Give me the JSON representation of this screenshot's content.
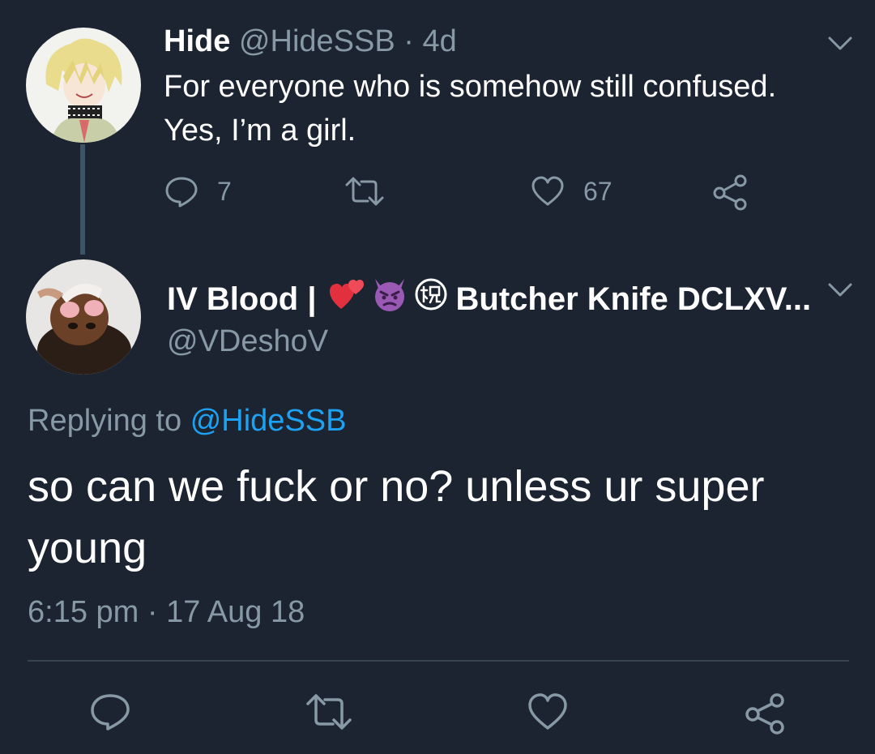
{
  "tweet": {
    "author_name": "Hide",
    "author_handle": "@HideSSB",
    "separator": "·",
    "age": "4d",
    "body_lines": [
      "For everyone who is somehow still confused.",
      "Yes, I’m a girl."
    ],
    "reply_count": "7",
    "like_count": "67"
  },
  "reply": {
    "author_name_prefix": "IV Blood |",
    "author_name_suffix": "Butcher Knife DCLXV...",
    "author_handle": "@VDeshoV",
    "replying_prefix": "Replying to",
    "replying_handle": "@HideSSB",
    "body_lines": [
      "so can we fuck or no? unless ur super",
      "young"
    ],
    "timestamp": "6:15 pm · 17 Aug 18"
  },
  "colors": {
    "background": "#1b2430",
    "muted": "#8899a6",
    "link": "#1da1f2",
    "thread_line": "#3d5466"
  },
  "icons": {
    "tweet_actions": [
      "reply-icon",
      "retweet-icon",
      "like-icon",
      "share-icon"
    ],
    "name_emojis": [
      "two-hearts-emoji",
      "angry-devil-emoji",
      "congratulations-ideograph-emoji"
    ],
    "menu": "chevron-down-icon"
  }
}
